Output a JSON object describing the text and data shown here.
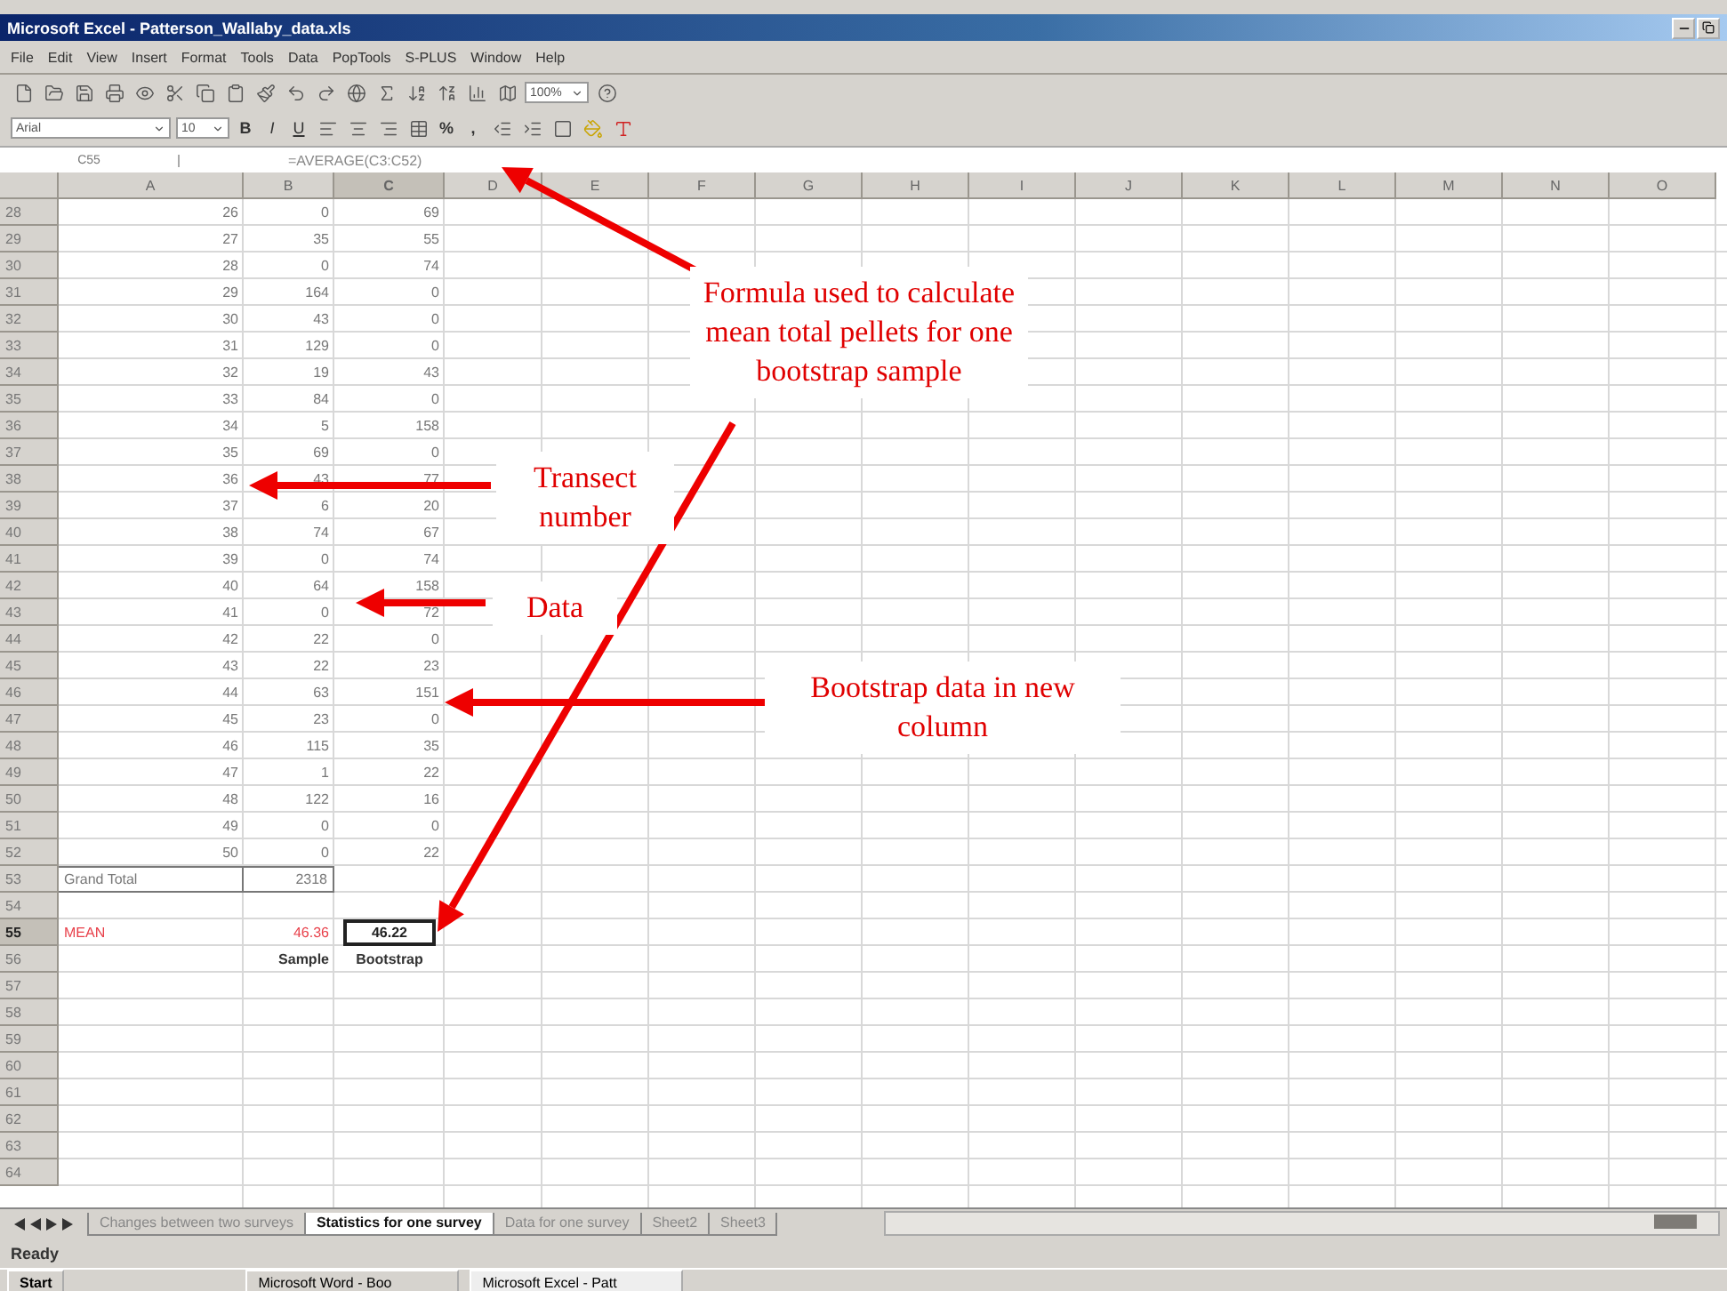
{
  "window": {
    "title": "Microsoft Excel - Patterson_Wallaby_data.xls"
  },
  "menu": [
    "File",
    "Edit",
    "View",
    "Insert",
    "Format",
    "Tools",
    "Data",
    "PopTools",
    "S-PLUS",
    "Window",
    "Help"
  ],
  "toolbar": {
    "zoom": "100%"
  },
  "format_toolbar": {
    "font": "Arial",
    "size": "10",
    "style_buttons": [
      "B",
      "I",
      "U"
    ],
    "number_buttons": [
      "%",
      ","
    ]
  },
  "formula_bar": {
    "name_box": "C55",
    "formula": "=AVERAGE(C3:C52)"
  },
  "columns": [
    {
      "label": "A",
      "selected": false
    },
    {
      "label": "B",
      "selected": false
    },
    {
      "label": "C",
      "selected": true
    },
    {
      "label": "D",
      "selected": false
    },
    {
      "label": "E",
      "selected": false
    },
    {
      "label": "F",
      "selected": false
    },
    {
      "label": "G",
      "selected": false
    },
    {
      "label": "H",
      "selected": false
    },
    {
      "label": "I",
      "selected": false
    },
    {
      "label": "J",
      "selected": false
    },
    {
      "label": "K",
      "selected": false
    },
    {
      "label": "L",
      "selected": false
    },
    {
      "label": "M",
      "selected": false
    },
    {
      "label": "N",
      "selected": false
    },
    {
      "label": "O",
      "selected": false
    }
  ],
  "rows": [
    {
      "header": "28",
      "kind": "data",
      "selected": false,
      "cells": [
        "26",
        "0",
        "69"
      ]
    },
    {
      "header": "29",
      "kind": "data",
      "selected": false,
      "cells": [
        "27",
        "35",
        "55"
      ]
    },
    {
      "header": "30",
      "kind": "data",
      "selected": false,
      "cells": [
        "28",
        "0",
        "74"
      ]
    },
    {
      "header": "31",
      "kind": "data",
      "selected": false,
      "cells": [
        "29",
        "164",
        "0"
      ]
    },
    {
      "header": "32",
      "kind": "data",
      "selected": false,
      "cells": [
        "30",
        "43",
        "0"
      ]
    },
    {
      "header": "33",
      "kind": "data",
      "selected": false,
      "cells": [
        "31",
        "129",
        "0"
      ]
    },
    {
      "header": "34",
      "kind": "data",
      "selected": false,
      "cells": [
        "32",
        "19",
        "43"
      ]
    },
    {
      "header": "35",
      "kind": "data",
      "selected": false,
      "cells": [
        "33",
        "84",
        "0"
      ]
    },
    {
      "header": "36",
      "kind": "data",
      "selected": false,
      "cells": [
        "34",
        "5",
        "158"
      ]
    },
    {
      "header": "37",
      "kind": "data",
      "selected": false,
      "cells": [
        "35",
        "69",
        "0"
      ]
    },
    {
      "header": "38",
      "kind": "data",
      "selected": false,
      "cells": [
        "36",
        "43",
        "77"
      ]
    },
    {
      "header": "39",
      "kind": "data",
      "selected": false,
      "cells": [
        "37",
        "6",
        "20"
      ]
    },
    {
      "header": "40",
      "kind": "data",
      "selected": false,
      "cells": [
        "38",
        "74",
        "67"
      ]
    },
    {
      "header": "41",
      "kind": "data",
      "selected": false,
      "cells": [
        "39",
        "0",
        "74"
      ]
    },
    {
      "header": "42",
      "kind": "data",
      "selected": false,
      "cells": [
        "40",
        "64",
        "158"
      ]
    },
    {
      "header": "43",
      "kind": "data",
      "selected": false,
      "cells": [
        "41",
        "0",
        "72"
      ]
    },
    {
      "header": "44",
      "kind": "data",
      "selected": false,
      "cells": [
        "42",
        "22",
        "0"
      ]
    },
    {
      "header": "45",
      "kind": "data",
      "selected": false,
      "cells": [
        "43",
        "22",
        "23"
      ]
    },
    {
      "header": "46",
      "kind": "data",
      "selected": false,
      "cells": [
        "44",
        "63",
        "151"
      ]
    },
    {
      "header": "47",
      "kind": "data",
      "selected": false,
      "cells": [
        "45",
        "23",
        "0"
      ]
    },
    {
      "header": "48",
      "kind": "data",
      "selected": false,
      "cells": [
        "46",
        "115",
        "35"
      ]
    },
    {
      "header": "49",
      "kind": "data",
      "selected": false,
      "cells": [
        "47",
        "1",
        "22"
      ]
    },
    {
      "header": "50",
      "kind": "data",
      "selected": false,
      "cells": [
        "48",
        "122",
        "16"
      ]
    },
    {
      "header": "51",
      "kind": "data",
      "selected": false,
      "cells": [
        "49",
        "0",
        "0"
      ]
    },
    {
      "header": "52",
      "kind": "data",
      "selected": false,
      "cells": [
        "50",
        "0",
        "22"
      ]
    },
    {
      "header": "53",
      "kind": "total",
      "selected": false,
      "cells": [
        "Grand Total",
        "2318"
      ]
    },
    {
      "header": "54",
      "kind": "blank",
      "selected": false,
      "cells": []
    },
    {
      "header": "55",
      "kind": "mean",
      "selected": true,
      "cells": [
        "MEAN",
        "46.36",
        "46.22"
      ]
    },
    {
      "header": "56",
      "kind": "labels",
      "selected": false,
      "cells": [
        "",
        "Sample",
        "Bootstrap"
      ]
    },
    {
      "header": "57",
      "kind": "blank",
      "selected": false,
      "cells": []
    },
    {
      "header": "58",
      "kind": "blank",
      "selected": false,
      "cells": []
    },
    {
      "header": "59",
      "kind": "blank",
      "selected": false,
      "cells": []
    },
    {
      "header": "60",
      "kind": "blank",
      "selected": false,
      "cells": []
    },
    {
      "header": "61",
      "kind": "blank",
      "selected": false,
      "cells": []
    },
    {
      "header": "62",
      "kind": "blank",
      "selected": false,
      "cells": []
    },
    {
      "header": "63",
      "kind": "blank",
      "selected": false,
      "cells": []
    },
    {
      "header": "64",
      "kind": "blank",
      "selected": false,
      "cells": []
    }
  ],
  "annotations": [
    {
      "text": "Formula used to calculate mean total pellets for one bootstrap sample"
    },
    {
      "text": "Transect number"
    },
    {
      "text": "Data"
    },
    {
      "text": "Bootstrap data in new column"
    }
  ],
  "sheet_tabs": [
    {
      "label": "Changes between two surveys",
      "selected": false
    },
    {
      "label": "Statistics for one survey",
      "selected": true
    },
    {
      "label": "Data for one survey",
      "selected": false
    },
    {
      "label": "Sheet2",
      "selected": false
    },
    {
      "label": "Sheet3",
      "selected": false
    }
  ],
  "status_bar": {
    "text": "Ready"
  },
  "taskbar": {
    "start": "Start",
    "windows": [
      "Microsoft Word - Boo",
      "Microsoft Excel - Patt"
    ]
  }
}
